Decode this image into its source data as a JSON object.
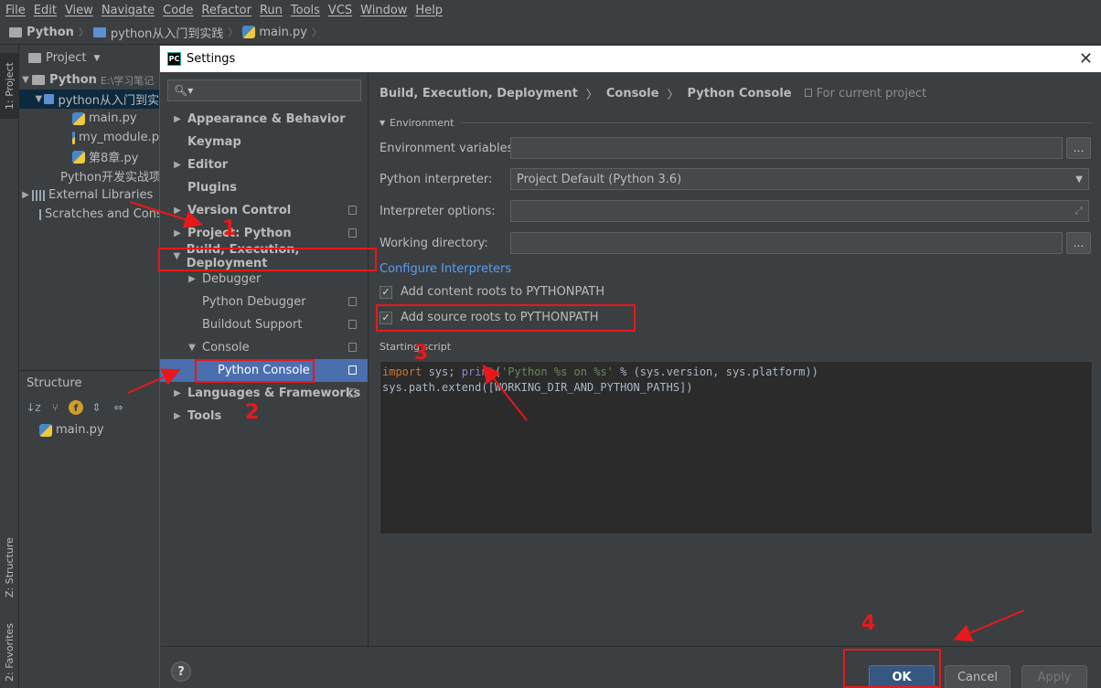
{
  "menu": [
    "File",
    "Edit",
    "View",
    "Navigate",
    "Code",
    "Refactor",
    "Run",
    "Tools",
    "VCS",
    "Window",
    "Help"
  ],
  "breadcrumb": [
    "Python",
    "python从入门到实践",
    "main.py"
  ],
  "left_strip": {
    "project": "1: Project",
    "structure": "Z: Structure",
    "favorites": "2: Favorites"
  },
  "project_panel": {
    "header": "Project",
    "root_label": "Python",
    "root_path": "E:\\学习笔记",
    "folder": "python从入门到实",
    "files": [
      "main.py",
      "my_module.p",
      "第8章.py"
    ],
    "other_folder": "Python开发实战项",
    "ext_libs": "External Libraries",
    "scratches": "Scratches and Cons"
  },
  "structure_panel": {
    "header": "Structure",
    "file": "main.py"
  },
  "dialog": {
    "title": "Settings",
    "tree": [
      {
        "label": "Appearance & Behavior"
      },
      {
        "label": "Keymap"
      },
      {
        "label": "Editor"
      },
      {
        "label": "Plugins"
      },
      {
        "label": "Version Control"
      },
      {
        "label": "Project: Python"
      },
      {
        "label": "Build, Execution, Deployment"
      },
      {
        "label": "Debugger"
      },
      {
        "label": "Python Debugger"
      },
      {
        "label": "Buildout Support"
      },
      {
        "label": "Console"
      },
      {
        "label": "Python Console"
      },
      {
        "label": "Languages & Frameworks"
      },
      {
        "label": "Tools"
      }
    ],
    "crumbs": [
      "Build, Execution, Deployment",
      "Console",
      "Python Console"
    ],
    "project_note": "For current project",
    "section_environment": "Environment",
    "env_vars_label": "Environment variables:",
    "interpreter_label": "Python interpreter:",
    "interpreter_value": "Project Default (Python 3.6)",
    "interp_options_label": "Interpreter options:",
    "working_dir_label": "Working directory:",
    "configure_link": "Configure Interpreters",
    "chk_content_roots": "Add content roots to PYTHONPATH",
    "chk_source_roots": "Add source roots to PYTHONPATH",
    "starting_script_label": "Starting script",
    "script": {
      "l1_kw": "import",
      "l1_a": " sys; ",
      "l1_fn": "print",
      "l1_b": "(",
      "l1_str": "'Python %s on %s'",
      "l1_c": " % (sys.version, sys.platform))",
      "l2": "sys.path.extend([WORKING_DIR_AND_PYTHON_PATHS])"
    },
    "buttons": {
      "help": "?",
      "ok": "OK",
      "cancel": "Cancel",
      "apply": "Apply"
    }
  },
  "annotations": [
    "1",
    "2",
    "3",
    "4"
  ]
}
